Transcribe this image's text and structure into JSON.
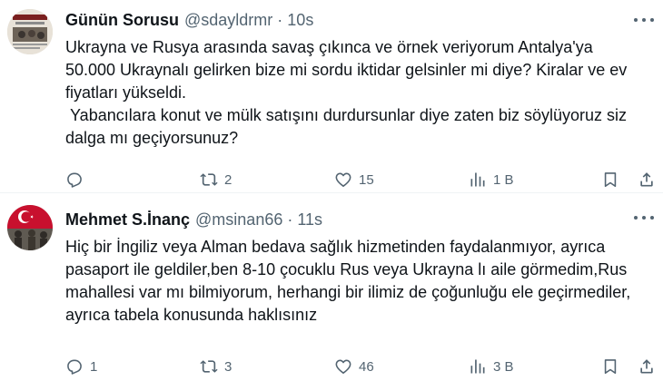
{
  "tweets": [
    {
      "display_name": "Günün Sorusu",
      "handle": "@sdayldrmr",
      "separator": "·",
      "time": "10s",
      "text": "Ukrayna ve Rusya arasında savaş çıkınca ve örnek veriyorum Antalya'ya 50.000 Ukraynalı gelirken bize mi sordu iktidar gelsinler mi diye? Kiralar ve ev fiyatları yükseldi.\n Yabancılara konut ve mülk satışını durdursunlar diye zaten biz söylüyoruz siz dalga mı geçiyorsunuz?",
      "reply_count": "",
      "retweet_count": "2",
      "like_count": "15",
      "view_count": "1 B",
      "avatar_icon": "newspaper-thumbnail-avatar"
    },
    {
      "display_name": "Mehmet S.İnanç",
      "handle": "@msinan66",
      "separator": "·",
      "time": "11s",
      "text": "Hiç bir İngiliz veya Alman bedava sağlık hizmetinden faydalanmıyor, ayrıca pasaport ile geldiler,ben 8-10 çocuklu Rus veya Ukrayna lı aile görmedim,Rus mahallesi var mı bilmiyorum, herhangi bir ilimiz de çoğunluğu ele geçirmediler, ayrıca tabela konusunda haklısınız",
      "reply_count": "1",
      "retweet_count": "3",
      "like_count": "46",
      "view_count": "3 B",
      "avatar_icon": "turkish-flag-soldiers-avatar"
    }
  ],
  "colors": {
    "text": "#0f1419",
    "muted": "#536471",
    "divider": "#eff3f4"
  }
}
